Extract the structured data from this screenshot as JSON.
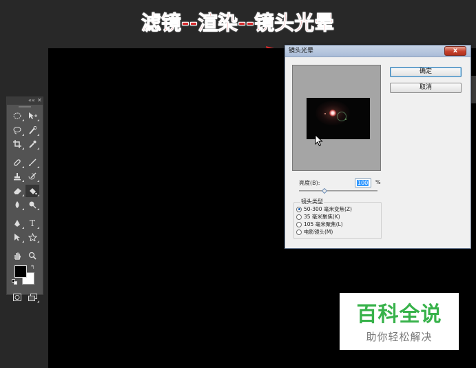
{
  "annotation": {
    "title": "滤镜--渲染--镜头光晕"
  },
  "dialog": {
    "title": "镜头光晕",
    "close_label": "x",
    "ok_label": "确定",
    "cancel_label": "取消",
    "brightness_label": "亮度(B):",
    "brightness_value": "100",
    "brightness_unit": "%",
    "brightness_percent": 100,
    "lens_type_label": "镜头类型",
    "lens_options": [
      {
        "label": "50-300 毫米变焦(Z)",
        "selected": true
      },
      {
        "label": "35 毫米聚焦(K)",
        "selected": false
      },
      {
        "label": "105 毫米聚焦(L)",
        "selected": false
      },
      {
        "label": "电影镜头(M)",
        "selected": false
      }
    ]
  },
  "toolbox": {
    "tools": [
      [
        "marquee-icon",
        "move-icon"
      ],
      [
        "lasso-icon",
        "quick-selection-icon"
      ],
      [
        "crop-icon",
        "eyedropper-icon"
      ],
      [
        "healing-brush-icon",
        "brush-icon"
      ],
      [
        "stamp-icon",
        "history-brush-icon"
      ],
      [
        "eraser-icon",
        "paint-bucket-icon"
      ],
      [
        "blur-icon",
        "dodge-icon"
      ],
      [
        "pen-icon",
        "type-icon"
      ],
      [
        "path-selection-icon",
        "shape-icon"
      ],
      [
        "hand-icon",
        "zoom-icon"
      ]
    ],
    "foreground_color": "#000000",
    "background_color": "#ffffff"
  },
  "watermark": {
    "title": "百科全说",
    "subtitle": "助你轻松解决"
  },
  "colors": {
    "annotation_red": "#d6282a",
    "watermark_green": "#37b24a"
  }
}
